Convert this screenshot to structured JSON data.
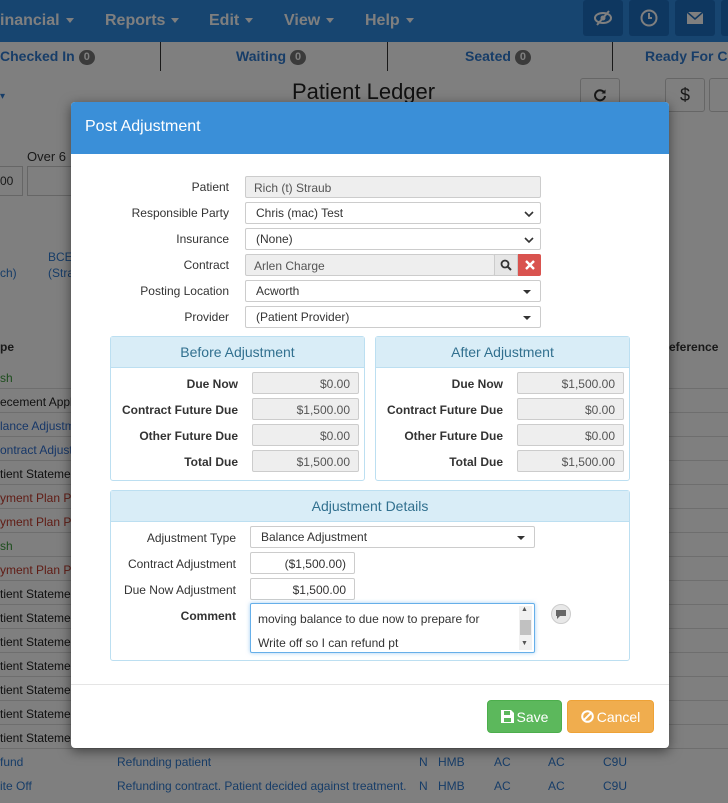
{
  "topnav": {
    "menus": [
      "inancial",
      "Reports",
      "Edit",
      "View",
      "Help"
    ],
    "icons": [
      "eye-slash-icon",
      "clock-icon",
      "envelope-icon",
      "more-icon"
    ]
  },
  "statusbar": {
    "items": [
      {
        "label": "Checked In",
        "count": "0"
      },
      {
        "label": "Waiting",
        "count": "0"
      },
      {
        "label": "Seated",
        "count": "0"
      },
      {
        "label": "Ready For C",
        "count": ""
      }
    ]
  },
  "background": {
    "page_title": "Patient Ledger",
    "over_label": "Over 6",
    "input_value": "00",
    "links": [
      "BCE",
      "(Stra",
      "ch)"
    ],
    "col_type": "pe",
    "col_reference": "eference",
    "dollar_btn": "$",
    "rows": [
      {
        "type": "sh",
        "color": "#3a9a3a"
      },
      {
        "type": "ecement Appl",
        "color": "#222"
      },
      {
        "type": "lance Adjustm",
        "color": "#2f6fd0"
      },
      {
        "type": "ontract Adjust",
        "color": "#2f6fd0"
      },
      {
        "type": "tient Stateme",
        "color": "#222"
      },
      {
        "type": "yment Plan P",
        "color": "#c0392b"
      },
      {
        "type": "yment Plan P",
        "color": "#c0392b"
      },
      {
        "type": "sh",
        "color": "#3a9a3a"
      },
      {
        "type": "yment Plan P",
        "color": "#c0392b"
      },
      {
        "type": "tient Stateme",
        "color": "#222"
      },
      {
        "type": "tient Stateme",
        "color": "#222"
      },
      {
        "type": "tient Stateme",
        "color": "#222"
      },
      {
        "type": "tient Stateme",
        "color": "#222"
      },
      {
        "type": "tient Stateme",
        "color": "#222"
      },
      {
        "type": "tient Stateme",
        "color": "#222"
      },
      {
        "type": "tient Stateme",
        "color": "#222"
      }
    ],
    "bottom_rows": [
      {
        "type": "fund",
        "desc": "Refunding patient",
        "n": "N",
        "c1": "HMB",
        "c2": "AC",
        "c3": "AC",
        "c4": "C9U"
      },
      {
        "type": "ite Off",
        "desc": "Refunding contract. Patient decided against treatment.",
        "n": "N",
        "c1": "HMB",
        "c2": "AC",
        "c3": "AC",
        "c4": "C9U"
      }
    ]
  },
  "modal": {
    "title": "Post Adjustment",
    "fields": {
      "patient_label": "Patient",
      "patient_value": "Rich (t) Straub",
      "responsible_label": "Responsible Party",
      "responsible_value": "Chris (mac) Test",
      "insurance_label": "Insurance",
      "insurance_value": "(None)",
      "contract_label": "Contract",
      "contract_value": "Arlen Charge",
      "location_label": "Posting Location",
      "location_value": "Acworth",
      "provider_label": "Provider",
      "provider_value": "(Patient Provider)"
    },
    "before": {
      "title": "Before Adjustment",
      "rows": [
        {
          "label": "Due Now",
          "value": "$0.00"
        },
        {
          "label": "Contract Future Due",
          "value": "$1,500.00"
        },
        {
          "label": "Other Future Due",
          "value": "$0.00"
        },
        {
          "label": "Total Due",
          "value": "$1,500.00"
        }
      ]
    },
    "after": {
      "title": "After Adjustment",
      "rows": [
        {
          "label": "Due Now",
          "value": "$1,500.00"
        },
        {
          "label": "Contract Future Due",
          "value": "$0.00"
        },
        {
          "label": "Other Future Due",
          "value": "$0.00"
        },
        {
          "label": "Total Due",
          "value": "$1,500.00"
        }
      ]
    },
    "details": {
      "title": "Adjustment Details",
      "type_label": "Adjustment Type",
      "type_value": "Balance Adjustment",
      "contract_adj_label": "Contract Adjustment",
      "contract_adj_value": "($1,500.00)",
      "due_now_adj_label": "Due Now Adjustment",
      "due_now_adj_value": "$1,500.00",
      "comment_label": "Comment",
      "comment_line1": "moving balance to due now to prepare for",
      "comment_line2": "Write off so I can refund pt"
    },
    "save_label": "Save",
    "cancel_label": "Cancel"
  },
  "colors": {
    "nav": "#2f8ae0",
    "header": "#3a8fd8",
    "panel_head": "#d9edf7",
    "save": "#5cb85c",
    "cancel": "#f0ad4e",
    "danger": "#d9534f"
  }
}
